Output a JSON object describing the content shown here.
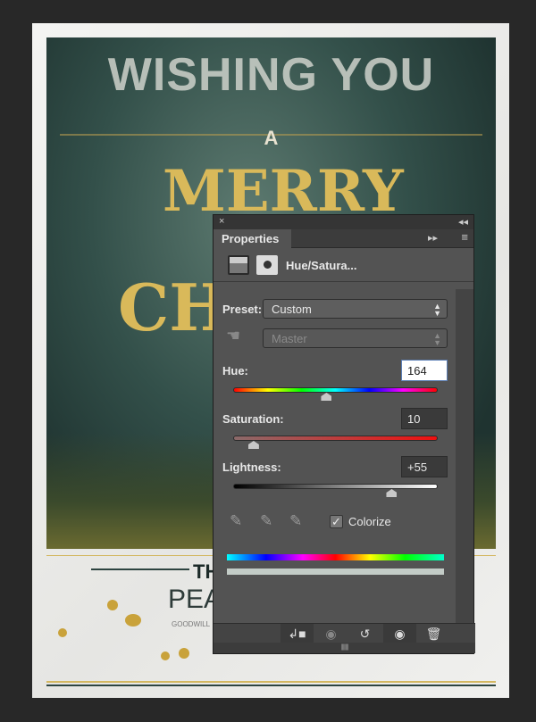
{
  "poster": {
    "line1": "WISHING YOU",
    "line2": "A",
    "line3": "MERRY",
    "line4": "CHR",
    "line5": "TH",
    "line6": "PEA",
    "line7": "GOODWILL"
  },
  "panel": {
    "close": "×",
    "collapse": "◂◂",
    "tab": "Properties",
    "tab_expand": "▸▸",
    "menu": "≡",
    "adjustment_name": "Hue/Satura...",
    "preset_label": "Preset:",
    "preset_value": "Custom",
    "channel_value": "Master",
    "hue": {
      "label": "Hue:",
      "value": "164",
      "fraction": 0.456
    },
    "saturation": {
      "label": "Saturation:",
      "value": "10",
      "fraction": 0.1
    },
    "lightness": {
      "label": "Lightness:",
      "value": "+55",
      "fraction": 0.775
    },
    "colorize_label": "Colorize",
    "colorize_checked": true,
    "colors": {
      "colorize_result": "#c3ccc7"
    }
  }
}
